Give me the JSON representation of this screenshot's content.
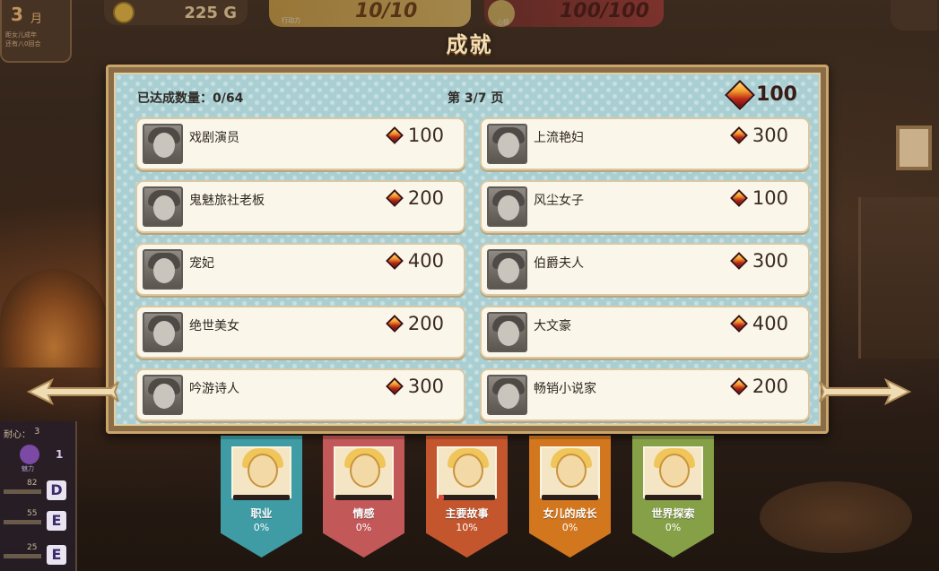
{
  "hud": {
    "month_number": "3",
    "month_unit": "月",
    "month_note_line1": "距女儿成年",
    "month_note_line2": "还有八0回合",
    "gold": "225",
    "gold_unit": "G",
    "stamina_label": "行动力",
    "stamina": "10/10",
    "mood_label": "心情",
    "mood": "100/100"
  },
  "title": "成就",
  "panel": {
    "count_label": "已达成数量：0/64",
    "page_label": "第 3/7 页",
    "total_points": "100"
  },
  "achievements": [
    {
      "name": "戏剧演员",
      "points": "100"
    },
    {
      "name": "上流艳妇",
      "points": "300"
    },
    {
      "name": "鬼魅旅社老板",
      "points": "200"
    },
    {
      "name": "风尘女子",
      "points": "100"
    },
    {
      "name": "宠妃",
      "points": "400"
    },
    {
      "name": "伯爵夫人",
      "points": "300"
    },
    {
      "name": "绝世美女",
      "points": "200"
    },
    {
      "name": "大文豪",
      "points": "400"
    },
    {
      "name": "吟游诗人",
      "points": "300"
    },
    {
      "name": "畅销小说家",
      "points": "200"
    }
  ],
  "categories": [
    {
      "label": "职业",
      "percent": "0%",
      "progress": 0
    },
    {
      "label": "情感",
      "percent": "0%",
      "progress": 0
    },
    {
      "label": "主要故事",
      "percent": "10%",
      "progress": 0.1
    },
    {
      "label": "女儿的成长",
      "percent": "0%",
      "progress": 0
    },
    {
      "label": "世界探索",
      "percent": "0%",
      "progress": 0
    }
  ],
  "side": {
    "top_label": "耐心：",
    "top_value": "3",
    "charm_label": "魅力",
    "charm_value": "1",
    "stats": [
      {
        "value": "82",
        "grade": "D"
      },
      {
        "value": "55",
        "grade": "E"
      },
      {
        "value": "25",
        "grade": "E"
      }
    ]
  },
  "colors": {
    "panel_bg": "#a9cfd3",
    "card_bg": "#fbf6ea",
    "banner_job": "#3f9ba4",
    "banner_emotion": "#c25858",
    "banner_story": "#c4562e",
    "banner_growth": "#d3771f",
    "banner_world": "#86a048"
  }
}
